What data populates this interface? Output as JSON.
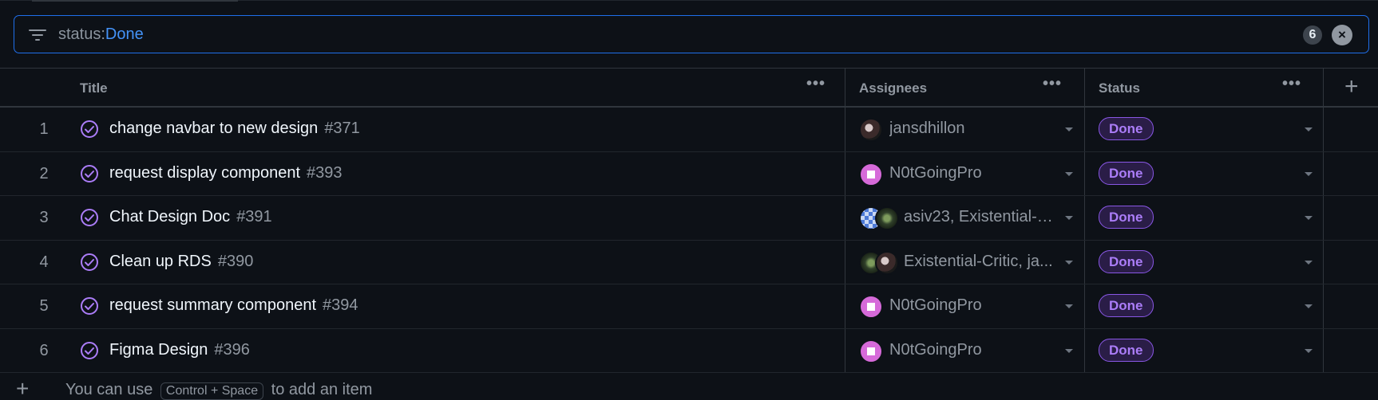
{
  "filter": {
    "key": "status:",
    "value": "Done",
    "count": "6",
    "clear_label": "×"
  },
  "columns": {
    "title": "Title",
    "assignees": "Assignees",
    "status": "Status",
    "more": "•••",
    "add": "+"
  },
  "rows": [
    {
      "num": "1",
      "title": "change navbar to new design",
      "issue": "#371",
      "assignees": "jansdhillon",
      "avatars": [
        "dark"
      ],
      "status": "Done"
    },
    {
      "num": "2",
      "title": "request display component",
      "issue": "#393",
      "assignees": "N0tGoingPro",
      "avatars": [
        "pink"
      ],
      "status": "Done"
    },
    {
      "num": "3",
      "title": "Chat Design Doc",
      "issue": "#391",
      "assignees": "asiv23, Existential-C...",
      "avatars": [
        "blue",
        "green"
      ],
      "status": "Done"
    },
    {
      "num": "4",
      "title": "Clean up RDS",
      "issue": "#390",
      "assignees": "Existential-Critic, ja...",
      "avatars": [
        "green",
        "dark"
      ],
      "status": "Done"
    },
    {
      "num": "5",
      "title": "request summary component",
      "issue": "#394",
      "assignees": "N0tGoingPro",
      "avatars": [
        "pink"
      ],
      "status": "Done"
    },
    {
      "num": "6",
      "title": "Figma Design",
      "issue": "#396",
      "assignees": "N0tGoingPro",
      "avatars": [
        "pink"
      ],
      "status": "Done"
    }
  ],
  "add_item": {
    "plus": "+",
    "prefix": "You can use",
    "shortcut": "Control + Space",
    "suffix": "to add an item"
  },
  "colors": {
    "background": "#0d1117",
    "accent": "#1f6feb",
    "done": "#ab7df8"
  }
}
